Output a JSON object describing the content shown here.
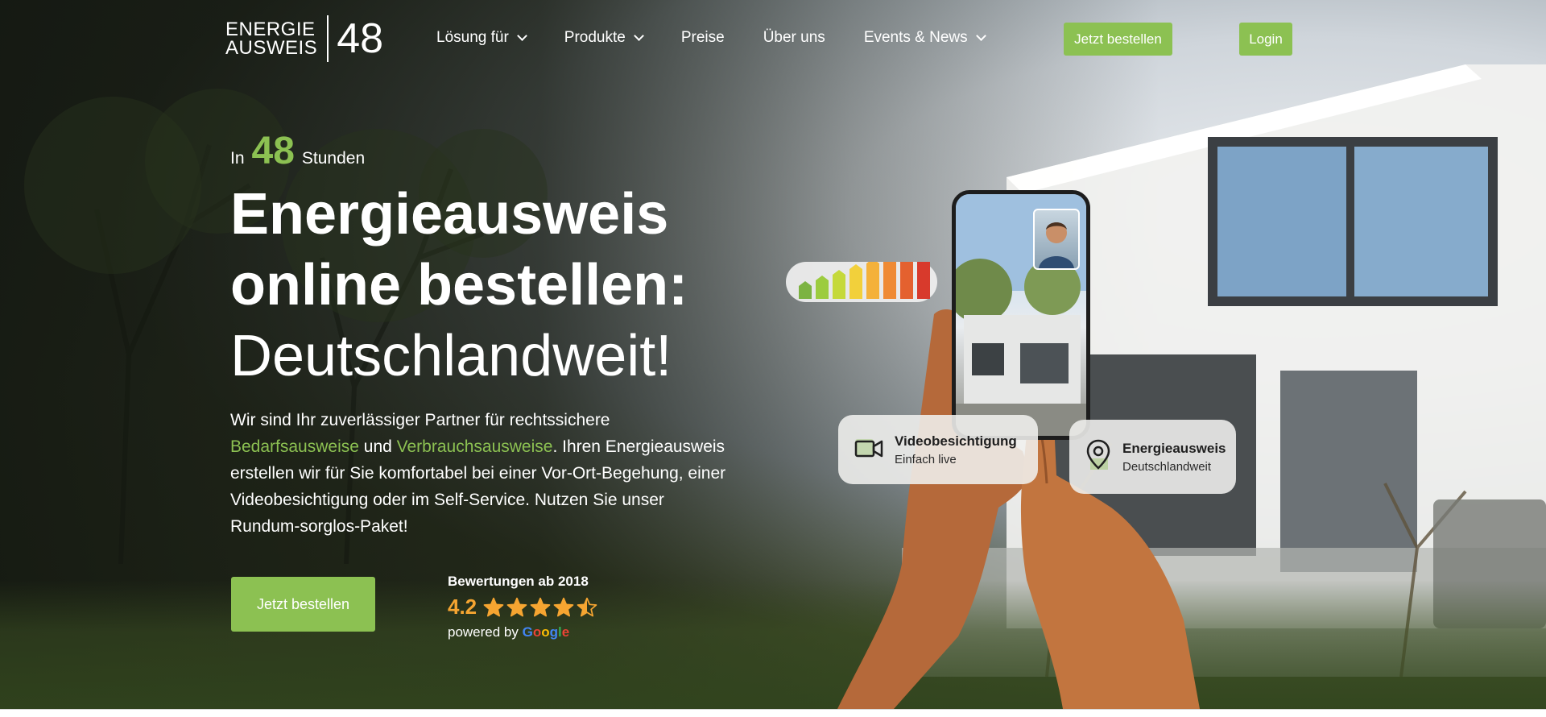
{
  "logo": {
    "line1": "ENERGIE",
    "line2": "AUSWEIS",
    "number": "48"
  },
  "nav": {
    "items": [
      {
        "label": "Lösung für",
        "dropdown": true
      },
      {
        "label": "Produkte",
        "dropdown": true
      },
      {
        "label": "Preise",
        "dropdown": false
      },
      {
        "label": "Über uns",
        "dropdown": false
      },
      {
        "label": "Events & News",
        "dropdown": true
      }
    ],
    "order_button": "Jetzt bestellen",
    "login_button": "Login"
  },
  "hero": {
    "kicker_prefix": "In",
    "kicker_number": "48",
    "kicker_suffix": "Stunden",
    "title_line1": "Energieausweis",
    "title_line2": "online bestellen:",
    "title_line3": "Deutschlandweit!",
    "desc_part1": "Wir sind Ihr zuverlässiger Partner für rechtssichere",
    "desc_link1": "Bedarfsausweise",
    "desc_part2": "und",
    "desc_link2": "Verbrauchsausweise",
    "desc_part3": ". Ihren Energieausweis erstellen wir für Sie komfortabel bei einer Vor-Ort-Begehung, einer Videobesichtigung oder im Self-Service. Nutzen Sie unser Rundum-sorglos-Paket!",
    "cta_label": "Jetzt bestellen"
  },
  "rating": {
    "label": "Bewertungen ab 2018",
    "score": "4.2",
    "stars": 4.5,
    "powered_by": "powered by",
    "provider_letters": [
      "G",
      "o",
      "o",
      "g",
      "l",
      "e"
    ]
  },
  "cards": {
    "video_title": "Videobesichtigung",
    "video_sub": "Einfach live",
    "energy_title": "Energieausweis",
    "energy_sub": "Deutschlandweit"
  },
  "colors": {
    "accent": "#8cc152",
    "star": "#f6a531",
    "energy_scale": [
      "#7cb342",
      "#9ccc3f",
      "#c5d93a",
      "#f2d03b",
      "#f4b13a",
      "#ef8a34",
      "#e4612f",
      "#d83a2c"
    ],
    "google": [
      "#4285f4",
      "#ea4335",
      "#fbbc05",
      "#4285f4",
      "#34a853",
      "#ea4335"
    ]
  }
}
